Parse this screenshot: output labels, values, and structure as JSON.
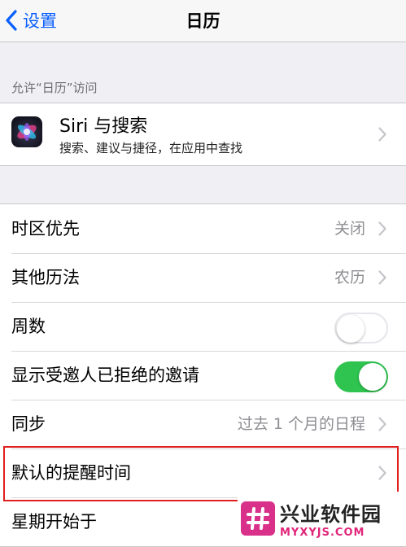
{
  "nav": {
    "back_label": "设置",
    "title": "日历"
  },
  "section": {
    "header": "允许“日历”访问"
  },
  "siri": {
    "title": "Siri 与搜索",
    "subtitle": "搜索、建议与捷径，在应用中查找"
  },
  "rows": [
    {
      "label": "时区优先",
      "value": "关闭",
      "type": "chevron"
    },
    {
      "label": "其他历法",
      "value": "农历",
      "type": "chevron"
    },
    {
      "label": "周数",
      "type": "toggle",
      "state": "off"
    },
    {
      "label": "显示受邀人已拒绝的邀请",
      "type": "toggle",
      "state": "on"
    },
    {
      "label": "同步",
      "value": "过去 1 个月的日程",
      "type": "chevron"
    },
    {
      "label": "默认的提醒时间",
      "value": "",
      "type": "chevron",
      "highlighted": true
    },
    {
      "label": "星期开始于",
      "type": "chevron"
    }
  ],
  "watermark": {
    "name": "兴业软件园",
    "url": "MYXYJS.COM"
  },
  "colors": {
    "accent": "#0a60ff",
    "toggle_on": "#2ec44f",
    "highlight": "#e02020",
    "watermark": "#d9308a"
  }
}
